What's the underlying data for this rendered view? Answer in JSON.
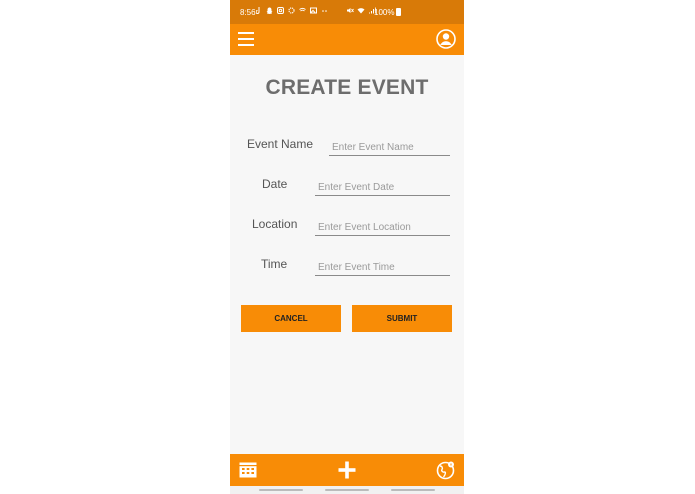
{
  "status_bar": {
    "time": "8:56",
    "battery": "100%"
  },
  "app_bar": {
    "menu_icon": "hamburger-menu-icon",
    "profile_icon": "account-circle-icon"
  },
  "page": {
    "title": "CREATE EVENT"
  },
  "form": {
    "fields": [
      {
        "label": "Event Name",
        "placeholder": "Enter Event Name"
      },
      {
        "label": "Date",
        "placeholder": "Enter Event Date"
      },
      {
        "label": "Location",
        "placeholder": "Enter Event Location"
      },
      {
        "label": "Time",
        "placeholder": "Enter Event Time"
      }
    ]
  },
  "buttons": {
    "cancel_label": "CANCEL",
    "submit_label": "SUBMIT"
  },
  "bottom_nav": {
    "items": [
      {
        "icon": "calendar-icon"
      },
      {
        "icon": "plus-icon"
      },
      {
        "icon": "globe-icon"
      }
    ]
  },
  "colors": {
    "accent": "#f88c06",
    "status_bar": "#d87a08",
    "background": "#f7f7f7",
    "title_text": "#6d6d6d"
  }
}
